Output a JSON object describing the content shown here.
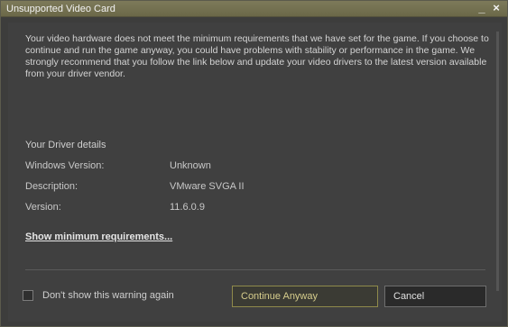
{
  "window": {
    "title": "Unsupported Video Card",
    "minimize_glyph": "_",
    "close_glyph": "×"
  },
  "message": "Your video hardware does not meet the minimum requirements that we have set for the game.  If you choose to continue and run the game anyway, you could have problems with stability or performance in the game.  We strongly recommend that you follow the link below and update your video drivers to the latest version available  from your driver vendor.",
  "details": {
    "title": "Your Driver details",
    "rows": [
      {
        "label": "Windows Version:",
        "value": "Unknown"
      },
      {
        "label": "Description:",
        "value": "VMware SVGA II"
      },
      {
        "label": "Version:",
        "value": "11.6.0.9"
      }
    ]
  },
  "link": {
    "label": "Show minimum requirements..."
  },
  "footer": {
    "checkbox_label": "Don't show this warning again",
    "continue_label": "Continue Anyway",
    "cancel_label": "Cancel"
  },
  "colors": {
    "titlebar": "#7d7a5a",
    "background": "#404040",
    "accent_border": "#8f8a4b"
  }
}
